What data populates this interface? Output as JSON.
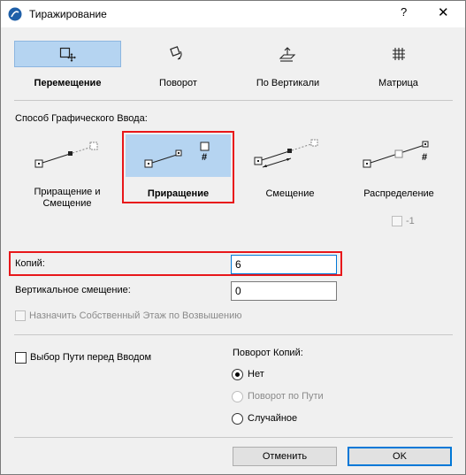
{
  "window": {
    "title": "Тиражирование",
    "help": "?",
    "close": "✕"
  },
  "modes": [
    {
      "label": "Перемещение",
      "icon": "move-icon",
      "active": true
    },
    {
      "label": "Поворот",
      "icon": "rotate-icon",
      "active": false
    },
    {
      "label": "По Вертикали",
      "icon": "vertical-icon",
      "active": false
    },
    {
      "label": "Матрица",
      "icon": "grid-icon",
      "active": false
    }
  ],
  "input_method": {
    "section_label": "Способ Графического Ввода:",
    "options": [
      {
        "label": "Приращение и Смещение",
        "icon": "increment-offset-icon"
      },
      {
        "label": "Приращение",
        "icon": "increment-icon",
        "selected": true
      },
      {
        "label": "Смещение",
        "icon": "offset-icon"
      },
      {
        "label": "Распределение",
        "icon": "distribute-icon"
      }
    ],
    "distribute_checkbox_label": "-1",
    "hash_symbol": "#"
  },
  "fields": {
    "copies_label": "Копий:",
    "copies_value": "6",
    "vertical_offset_label": "Вертикальное смещение:",
    "vertical_offset_value": "0",
    "own_floor_label": "Назначить Собственный Этаж по Возвышению"
  },
  "path": {
    "checkbox_label": "Выбор Пути перед Вводом"
  },
  "rotation": {
    "heading": "Поворот Копий:",
    "options": [
      {
        "label": "Нет",
        "checked": true,
        "disabled": false
      },
      {
        "label": "Поворот по Пути",
        "checked": false,
        "disabled": true
      },
      {
        "label": "Случайное",
        "checked": false,
        "disabled": false
      }
    ]
  },
  "buttons": {
    "cancel": "Отменить",
    "ok": "OK"
  },
  "colors": {
    "highlight": "#e8171a",
    "active_blue": "#b5d4f1",
    "accent": "#0078d7"
  }
}
